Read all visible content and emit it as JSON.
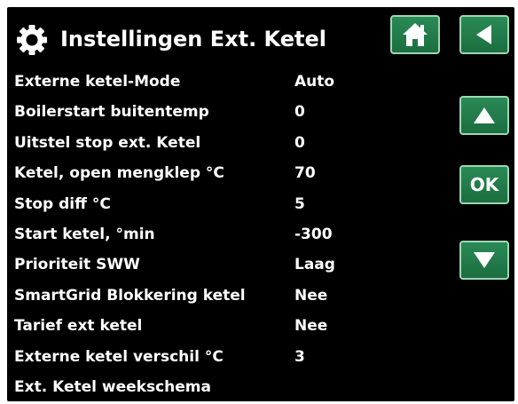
{
  "header": {
    "title": "Instellingen Ext. Ketel",
    "icon": "gear-icon"
  },
  "buttons": {
    "home_icon": "home-icon",
    "back_icon": "back-arrow-icon",
    "up_icon": "up-arrow-icon",
    "ok_label": "OK",
    "down_icon": "down-arrow-icon"
  },
  "colors": {
    "background": "#000000",
    "text": "#ffffff",
    "button": "#1f7a46",
    "button_border": "#9fd6b5"
  },
  "settings": [
    {
      "label": "Externe ketel-Mode",
      "value": "Auto"
    },
    {
      "label": "Boilerstart buitentemp",
      "value": "0"
    },
    {
      "label": "Uitstel stop ext. Ketel",
      "value": "0"
    },
    {
      "label": "Ketel, open mengklep °C",
      "value": "70"
    },
    {
      "label": "Stop diff °C",
      "value": "5"
    },
    {
      "label": "Start ketel, °min",
      "value": "-300"
    },
    {
      "label": "Prioriteit SWW",
      "value": "Laag"
    },
    {
      "label": "SmartGrid Blokkering ketel",
      "value": "Nee"
    },
    {
      "label": "Tarief ext ketel",
      "value": "Nee"
    },
    {
      "label": "Externe ketel verschil °C",
      "value": "3"
    },
    {
      "label": "Ext. Ketel weekschema",
      "value": ""
    }
  ]
}
